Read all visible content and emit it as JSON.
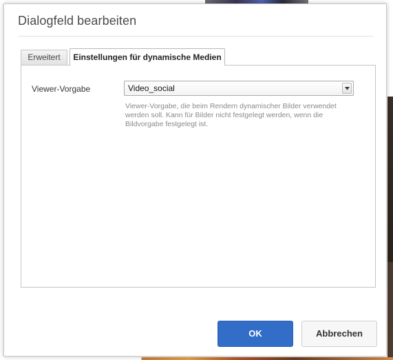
{
  "dialog": {
    "title": "Dialogfeld bearbeiten"
  },
  "tabs": [
    {
      "label": "Erweitert",
      "active": false
    },
    {
      "label": "Einstellungen für dynamische Medien",
      "active": true
    }
  ],
  "field": {
    "label": "Viewer-Vorgabe",
    "selected_value": "Video_social",
    "help_text": "Viewer-Vorgabe, die beim Rendern dynamischer Bilder verwendet werden soll. Kann für Bilder nicht festgelegt werden, wenn die Bildvorgabe festgelegt ist."
  },
  "buttons": {
    "ok_label": "OK",
    "cancel_label": "Abbrechen"
  },
  "colors": {
    "primary_button": "#326ec8",
    "help_text": "#8a8a8a"
  },
  "icons": {
    "select_arrow": "chevron-down-icon"
  }
}
